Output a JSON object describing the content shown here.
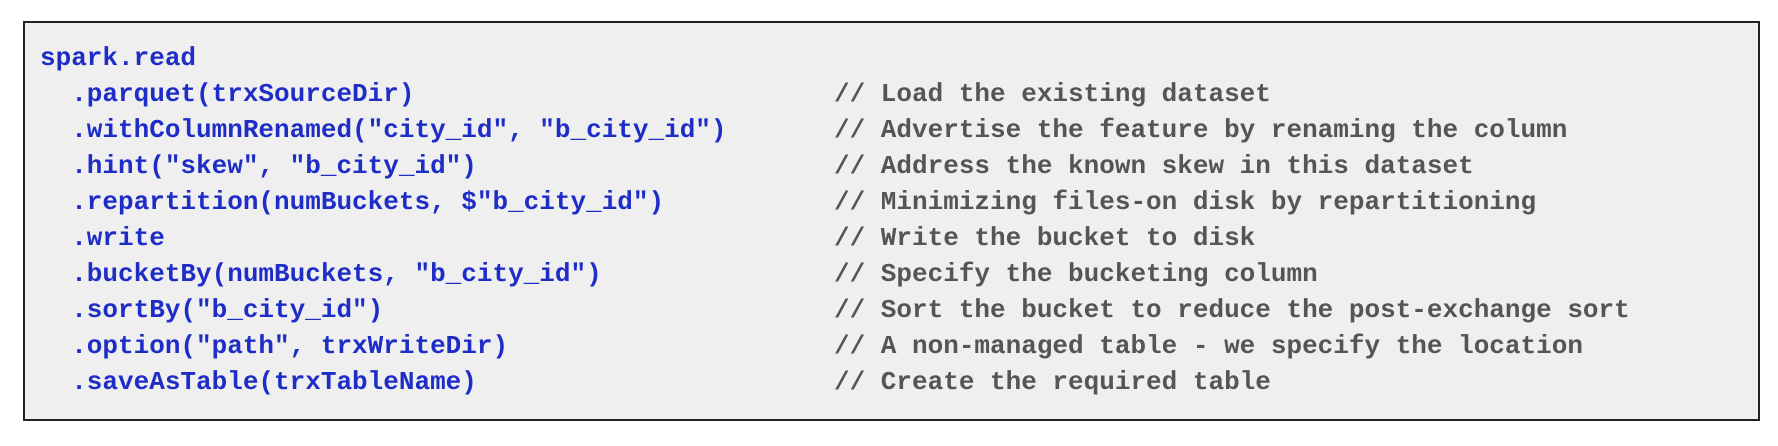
{
  "snippet": {
    "lines": [
      {
        "code": "spark.read",
        "comment": ""
      },
      {
        "code": "  .parquet(trxSourceDir)",
        "comment": "// Load the existing dataset"
      },
      {
        "code": "  .withColumnRenamed(\"city_id\", \"b_city_id\")",
        "comment": "// Advertise the feature by renaming the column"
      },
      {
        "code": "  .hint(\"skew\", \"b_city_id\")",
        "comment": "// Address the known skew in this dataset"
      },
      {
        "code": "  .repartition(numBuckets, $\"b_city_id\")",
        "comment": "// Minimizing files-on disk by repartitioning"
      },
      {
        "code": "  .write",
        "comment": "// Write the bucket to disk"
      },
      {
        "code": "  .bucketBy(numBuckets, \"b_city_id\")",
        "comment": "// Specify the bucketing column"
      },
      {
        "code": "  .sortBy(\"b_city_id\")",
        "comment": "// Sort the bucket to reduce the post-exchange sort"
      },
      {
        "code": "  .option(\"path\", trxWriteDir)",
        "comment": "// A non-managed table - we specify the location"
      },
      {
        "code": "  .saveAsTable(trxTableName)",
        "comment": "// Create the required table"
      }
    ]
  }
}
